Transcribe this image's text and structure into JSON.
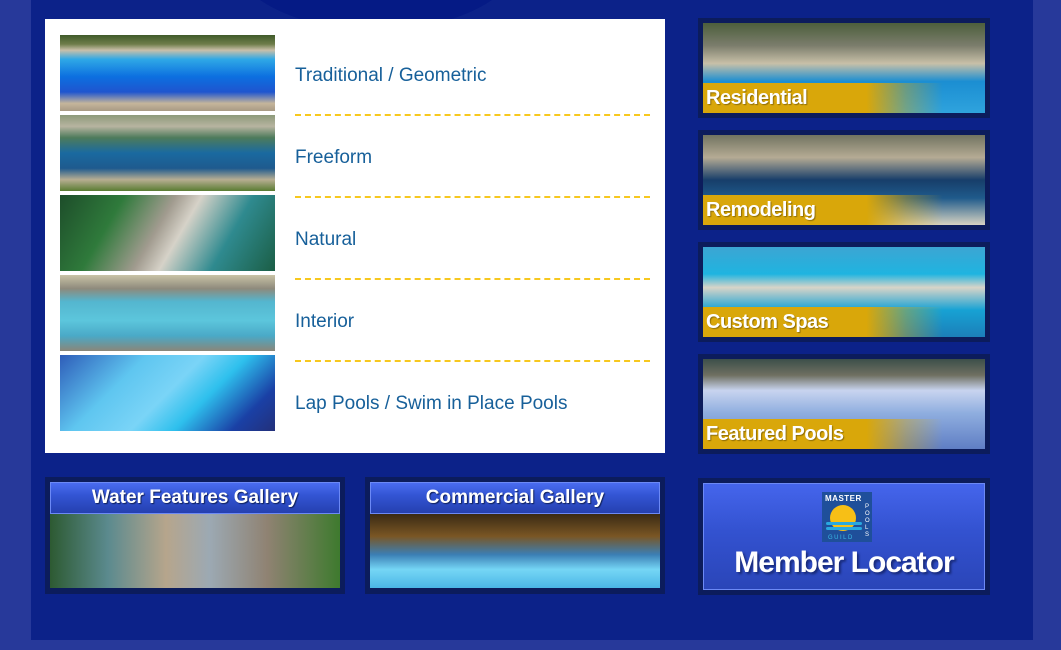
{
  "pool_styles": [
    {
      "label": "Traditional / Geometric",
      "image": "traditional-pool-photo"
    },
    {
      "label": "Freeform",
      "image": "freeform-pool-photo"
    },
    {
      "label": "Natural",
      "image": "natural-pool-photo"
    },
    {
      "label": "Interior",
      "image": "interior-pool-photo"
    },
    {
      "label": "Lap Pools / Swim in Place Pools",
      "image": "lap-pool-photo"
    }
  ],
  "categories": [
    {
      "label": "Residential"
    },
    {
      "label": "Remodeling"
    },
    {
      "label": "Custom Spas"
    },
    {
      "label": "Featured Pools"
    }
  ],
  "galleries": [
    {
      "label": "Water Features Gallery"
    },
    {
      "label": "Commercial Gallery"
    }
  ],
  "member_locator": {
    "label": "Member Locator",
    "logo": {
      "top": "MASTER",
      "side": "POOLS",
      "bottom": "GUILD"
    }
  },
  "colors": {
    "background": "#0c2289",
    "link_text": "#17609a",
    "divider": "#f7c81e",
    "label_band": "#d9a70a"
  }
}
